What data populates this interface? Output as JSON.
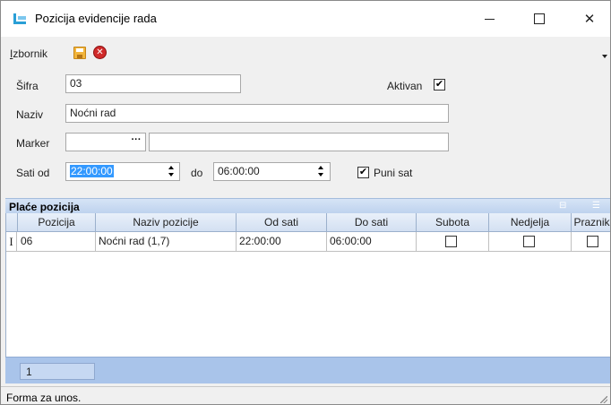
{
  "window": {
    "title": "Pozicija evidencije rada",
    "controls": {
      "minimize": "—",
      "close": "✕"
    }
  },
  "menu": {
    "label_underlined": "I",
    "label_rest": "zbornik",
    "save_icon": "save-icon",
    "cancel_icon": "cancel-icon",
    "cancel_glyph": "✕"
  },
  "form": {
    "sifra": {
      "label": "Šifra",
      "value": "03"
    },
    "aktivan": {
      "label": "Aktivan",
      "checked": true,
      "mark": "✔"
    },
    "naziv": {
      "label": "Naziv",
      "value": "Noćni rad"
    },
    "marker": {
      "label": "Marker",
      "code": "",
      "dots": "···",
      "description": ""
    },
    "sati_od": {
      "label": "Sati od",
      "value": "22:00:00"
    },
    "do": {
      "label": "do",
      "value": "06:00:00"
    },
    "puni_sat": {
      "label": "Puni sat",
      "checked": true,
      "mark": "✔"
    }
  },
  "section": {
    "title": "Plaće pozicija"
  },
  "grid": {
    "columns": [
      "Pozicija",
      "Naziv pozicije",
      "Od sati",
      "Do sati",
      "Subota",
      "Nedjelja",
      "Praznik"
    ],
    "rows": [
      {
        "marker": "I",
        "pozicija": "06",
        "naziv": "Noćni rad (1,7)",
        "od": "22:00:00",
        "do": "06:00:00",
        "subota": false,
        "nedjelja": false,
        "praznik": false
      }
    ]
  },
  "footer": {
    "page": "1"
  },
  "status": {
    "text": "Forma za unos."
  },
  "colors": {
    "accent": "#3399ff",
    "section_header": "#bed2ee",
    "footer_strip": "#a9c4ea",
    "app_icon": "#2a9fd6",
    "cancel": "#d02a2a",
    "save": "#f2b53b"
  }
}
